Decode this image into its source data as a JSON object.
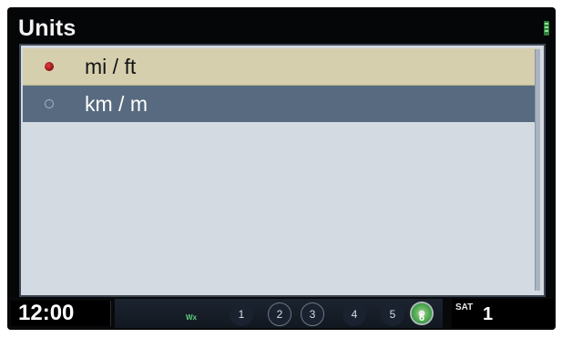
{
  "title": "Units",
  "options": [
    {
      "label": "mi / ft",
      "selected": true
    },
    {
      "label": "km / m",
      "selected": false
    }
  ],
  "status": {
    "time": "12:00",
    "weather_badge": "Wx",
    "presets": [
      "1",
      "2",
      "3",
      "4",
      "5",
      "6"
    ],
    "band": "SAT",
    "channel": "1"
  },
  "colors": {
    "selected_row": "#d6cfae",
    "focus_row": "#576a7f",
    "panel": "#d4dae2",
    "radio_on": "#c02020"
  }
}
